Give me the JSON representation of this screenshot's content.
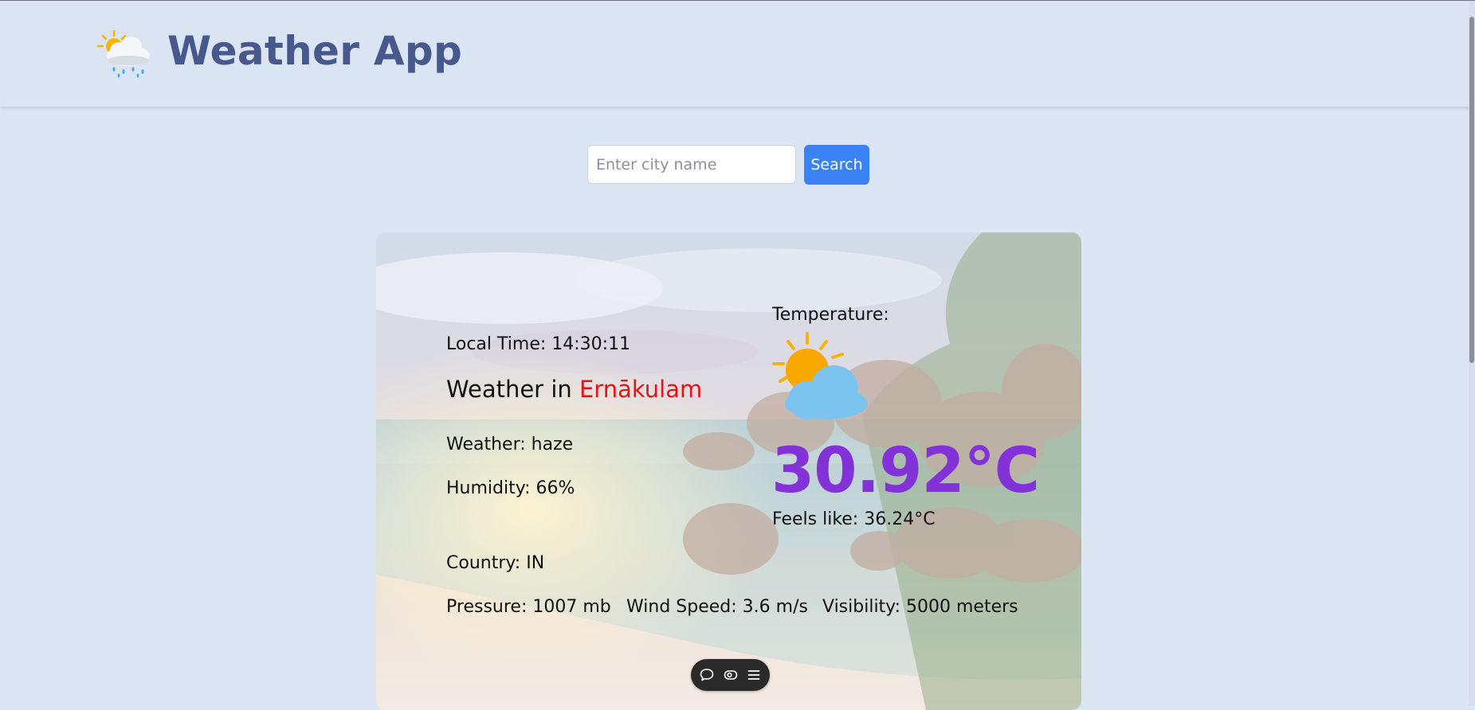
{
  "header": {
    "logo_icon": "sun-behind-rain-cloud-icon",
    "title": "Weather App"
  },
  "search": {
    "placeholder": "Enter city name",
    "value": "",
    "button_label": "Search"
  },
  "weather": {
    "local_time": "Local Time: 14:30:11",
    "heading_prefix": "Weather in ",
    "city": "Ernākulam",
    "condition": "Weather: haze",
    "humidity": "Humidity: 66%",
    "country": "Country: IN",
    "pressure": "Pressure: 1007 mb",
    "wind_speed": "Wind Speed: 3.6 m/s",
    "visibility": "Visibility: 5000 meters",
    "temperature_label": "Temperature:",
    "temperature": "30.92°C",
    "feels_like": "Feels like: 36.24°C",
    "condition_icon": "sun-behind-cloud-icon"
  },
  "toolbar": {
    "icons": [
      "comment-icon",
      "eye-icon",
      "menu-icon"
    ],
    "background": "#2a2a2a"
  },
  "colors": {
    "page_background": "#dce5f3",
    "title_color": "#47598c",
    "accent_button": "#3b82f6",
    "city_color": "#e31414",
    "temperature_color": "#8232d6"
  }
}
